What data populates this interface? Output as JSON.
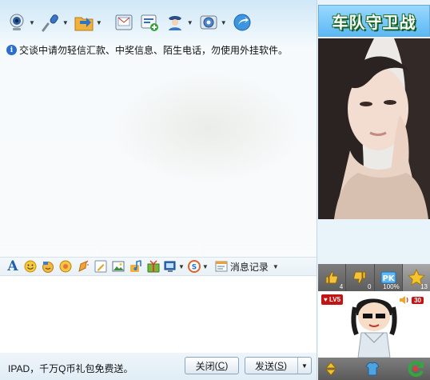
{
  "toolbar": {
    "items": [
      {
        "icon": "webcam-icon",
        "has_menu": true
      },
      {
        "icon": "microphone-icon",
        "has_menu": true
      },
      {
        "icon": "folder-transfer-icon",
        "has_menu": true
      },
      {
        "icon": "mail-icon",
        "has_menu": false
      },
      {
        "icon": "add-group-icon",
        "has_menu": false
      },
      {
        "icon": "user-info-icon",
        "has_menu": true
      },
      {
        "icon": "settings-icon",
        "has_menu": true
      },
      {
        "icon": "share-app-icon",
        "has_menu": false
      }
    ]
  },
  "warning": {
    "text": "交谈中请勿轻信汇款、中奖信息、陌生电话，勿使用外挂软件。"
  },
  "input_toolbar": {
    "font_label": "A",
    "history_label": "消息记录"
  },
  "bottom": {
    "ad_text": "IPAD，千万Q币礼包免费送。",
    "close_label": "关闭",
    "close_key": "C",
    "send_label": "发送",
    "send_key": "S"
  },
  "side": {
    "banner_text": "车队守卫战",
    "stats": [
      {
        "icon": "thumbs-up-icon",
        "value": "4"
      },
      {
        "icon": "thumbs-down-icon",
        "value": "0"
      },
      {
        "icon": "pk-icon",
        "value": "100%"
      },
      {
        "icon": "star-icon",
        "value": "13"
      }
    ],
    "level": "LV5",
    "volume": "30"
  },
  "colors": {
    "accent": "#1d5fae",
    "banner_bg": "#5bb8f4",
    "badge_red": "#c31414"
  }
}
